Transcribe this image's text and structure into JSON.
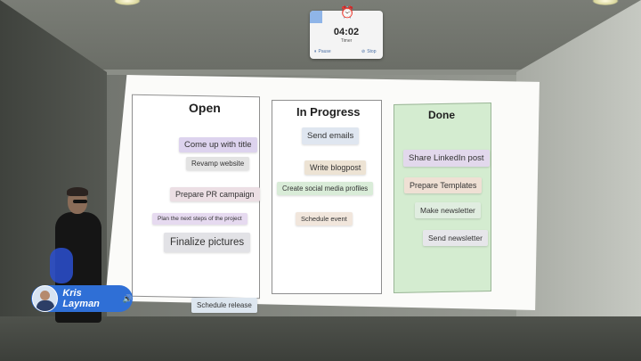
{
  "timer": {
    "time": "04:02",
    "label": "Timer",
    "pause_label": "Pause",
    "stop_label": "Stop"
  },
  "board": {
    "columns": [
      {
        "title": "Open",
        "notes": [
          {
            "text": "Come up with title",
            "color": "#ddd3ee"
          },
          {
            "text": "Revamp website",
            "color": "#e3e3e3"
          },
          {
            "text": "Prepare PR campaign",
            "color": "#ecdfe4"
          },
          {
            "text": "Plan the next steps of the project",
            "color": "#e6daf0"
          },
          {
            "text": "Finalize pictures",
            "color": "#e2e2e6"
          }
        ]
      },
      {
        "title": "In Progress",
        "notes": [
          {
            "text": "Send emails",
            "color": "#dfe6f0"
          },
          {
            "text": "Write blogpost",
            "color": "#ede3d4"
          },
          {
            "text": "Create social media profiles",
            "color": "#d9ecd8"
          },
          {
            "text": "Schedule event",
            "color": "#f1e6dc"
          }
        ]
      },
      {
        "title": "Done",
        "notes": [
          {
            "text": "Share LinkedIn post",
            "color": "#e2d8ec"
          },
          {
            "text": "Prepare Templates",
            "color": "#efe0d4"
          },
          {
            "text": "Make newsletter",
            "color": "#e0ede0"
          },
          {
            "text": "Send newsletter",
            "color": "#e6e6ea"
          }
        ]
      }
    ],
    "loose_notes": [
      {
        "text": "Schedule release",
        "color": "#dde6ef"
      }
    ]
  },
  "user": {
    "name": "Kris Layman",
    "tag_color": "#2f6fd6"
  }
}
